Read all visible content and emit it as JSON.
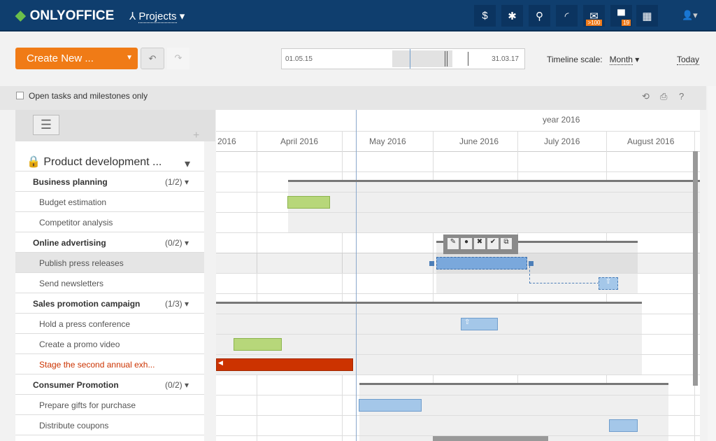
{
  "header": {
    "logo": "ONLYOFFICE",
    "module": "Projects",
    "mail_badge": ">100",
    "chat_badge": "19",
    "icons": [
      "dollar-icon",
      "settings-icon",
      "search-icon",
      "feed-icon",
      "mail-icon",
      "chat-icon",
      "calendar-icon",
      "user-icon"
    ]
  },
  "toolbar": {
    "create_label": "Create New ...",
    "range_start": "01.05.15",
    "range_end": "31.03.17",
    "scale_label": "Timeline scale:",
    "scale_value": "Month",
    "today": "Today"
  },
  "filter": {
    "label": "Open tasks and milestones only",
    "checked": false
  },
  "timeline": {
    "year": "year 2016",
    "months": [
      "2016",
      "April 2016",
      "May 2016",
      "June 2016",
      "July 2016",
      "August 2016"
    ]
  },
  "project": {
    "title": "Product development ..."
  },
  "rows": [
    {
      "label": "Business planning",
      "count": "(1/2)",
      "group": true
    },
    {
      "label": "Budget estimation"
    },
    {
      "label": "Competitor analysis"
    },
    {
      "label": "Online advertising",
      "count": "(0/2)",
      "group": true
    },
    {
      "label": "Publish press releases",
      "selected": true
    },
    {
      "label": "Send newsletters"
    },
    {
      "label": "Sales promotion campaign",
      "count": "(1/3)",
      "group": true
    },
    {
      "label": "Hold a press conference"
    },
    {
      "label": "Create a promo video"
    },
    {
      "label": "Stage the second annual exh...",
      "overdue": true
    },
    {
      "label": "Consumer Promotion",
      "count": "(0/2)",
      "group": true
    },
    {
      "label": "Prepare gifts for purchase"
    },
    {
      "label": "Distribute coupons"
    }
  ],
  "colors": {
    "accent": "#f07b16",
    "header": "#0f3e6e",
    "overdue": "#cc3300",
    "task": "#a4c7e9",
    "done": "#b7d77a"
  }
}
